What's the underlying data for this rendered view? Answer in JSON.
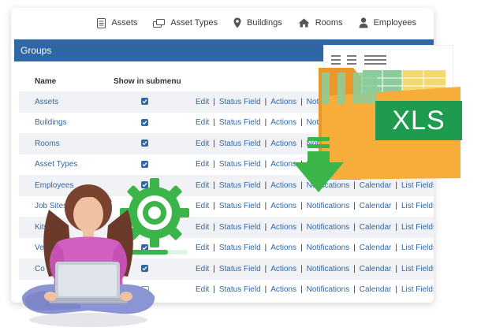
{
  "nav": {
    "items": [
      {
        "label": "Assets",
        "icon": "document-icon"
      },
      {
        "label": "Asset Types",
        "icon": "cards-icon"
      },
      {
        "label": "Buildings",
        "icon": "map-pin-icon"
      },
      {
        "label": "Rooms",
        "icon": "house-icon"
      },
      {
        "label": "Employees",
        "icon": "person-icon"
      }
    ]
  },
  "groups": {
    "title": "Groups",
    "columns": {
      "name": "Name",
      "show": "Show in submenu"
    },
    "rows": [
      {
        "name": "Assets",
        "checked": true
      },
      {
        "name": "Buildings",
        "checked": true
      },
      {
        "name": "Rooms",
        "checked": true
      },
      {
        "name": "Asset Types",
        "checked": true
      },
      {
        "name": "Employees",
        "checked": true
      },
      {
        "name": "Job Sites",
        "checked": true
      },
      {
        "name": "Kits",
        "checked": true
      },
      {
        "name": "Vehicles",
        "checked": true
      },
      {
        "name": "Co",
        "checked": true
      },
      {
        "name": "",
        "checked": false
      }
    ],
    "actions": {
      "edit": "Edit",
      "status_field": "Status Field",
      "actions": "Actions",
      "notifications": "Notifications",
      "calendar": "Calendar",
      "list_fields": "List Fields"
    }
  },
  "xls": {
    "label": "XLS"
  },
  "colors": {
    "header_blue": "#2f67a6",
    "link_blue": "#2f67a6",
    "folder_orange": "#f7ad3a",
    "xls_green": "#1e9b4f",
    "arrow_green": "#3bb54a",
    "gear_green": "#3bb54a"
  }
}
